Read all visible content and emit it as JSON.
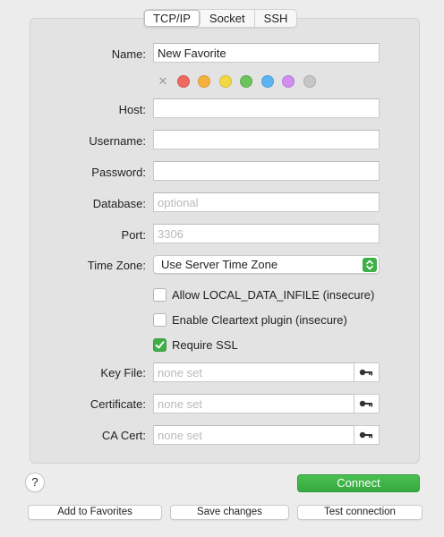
{
  "tabs": [
    {
      "label": "TCP/IP",
      "selected": true
    },
    {
      "label": "Socket",
      "selected": false
    },
    {
      "label": "SSH",
      "selected": false
    }
  ],
  "form": {
    "name": {
      "label": "Name:",
      "value": "New Favorite"
    },
    "colors": [
      "#ee6a5f",
      "#f5b13f",
      "#f2d843",
      "#6dc35b",
      "#5cb4f0",
      "#d08ef0",
      "#c7c7c7"
    ],
    "host": {
      "label": "Host:",
      "value": ""
    },
    "username": {
      "label": "Username:",
      "value": ""
    },
    "password": {
      "label": "Password:",
      "value": ""
    },
    "database": {
      "label": "Database:",
      "value": "",
      "placeholder": "optional"
    },
    "port": {
      "label": "Port:",
      "value": "",
      "placeholder": "3306"
    },
    "timezone": {
      "label": "Time Zone:",
      "value": "Use Server Time Zone"
    },
    "checkboxes": [
      {
        "label": "Allow LOCAL_DATA_INFILE (insecure)",
        "checked": false
      },
      {
        "label": "Enable Cleartext plugin (insecure)",
        "checked": false
      },
      {
        "label": "Require SSL",
        "checked": true
      }
    ],
    "key_file": {
      "label": "Key File:",
      "placeholder": "none set"
    },
    "certificate": {
      "label": "Certificate:",
      "placeholder": "none set"
    },
    "ca_cert": {
      "label": "CA Cert:",
      "placeholder": "none set"
    }
  },
  "help_label": "?",
  "connect_label": "Connect",
  "buttons": {
    "add_favorites": "Add to Favorites",
    "save_changes": "Save changes",
    "test_connection": "Test connection"
  }
}
